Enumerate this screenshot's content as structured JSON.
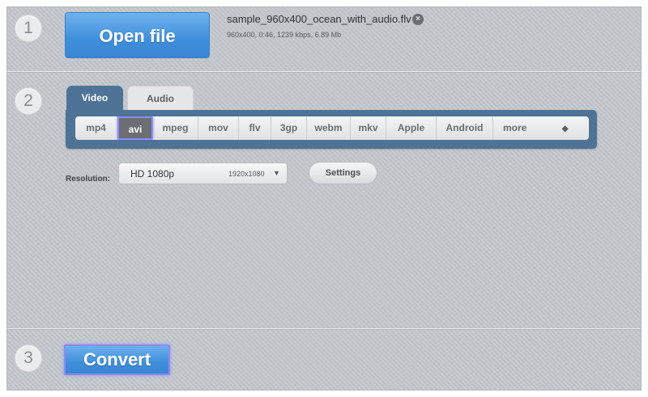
{
  "steps": {
    "one": "1",
    "two": "2",
    "three": "3"
  },
  "open_file": {
    "button_label": "Open file",
    "file_name": "sample_960x400_ocean_with_audio.flv",
    "file_meta": "960x400, 0:46, 1239 kbps, 6.89 Mb",
    "remove_glyph": "×"
  },
  "tabs": [
    {
      "label": "Video",
      "active": true
    },
    {
      "label": "Audio",
      "active": false
    }
  ],
  "formats": {
    "items": [
      "mp4",
      "avi",
      "mpeg",
      "mov",
      "flv",
      "3gp",
      "webm",
      "mkv",
      "Apple",
      "Android",
      "more"
    ],
    "selected": "avi",
    "more_arrows": "◆"
  },
  "resolution": {
    "label": "Resolution:",
    "value": "HD 1080p",
    "dims": "1920x1080",
    "caret": "▼"
  },
  "settings_label": "Settings",
  "convert_label": "Convert",
  "colors": {
    "accent_blue": "#3f8fdb",
    "tab_blue": "#4e7396",
    "highlight": "#8c8cf5"
  }
}
